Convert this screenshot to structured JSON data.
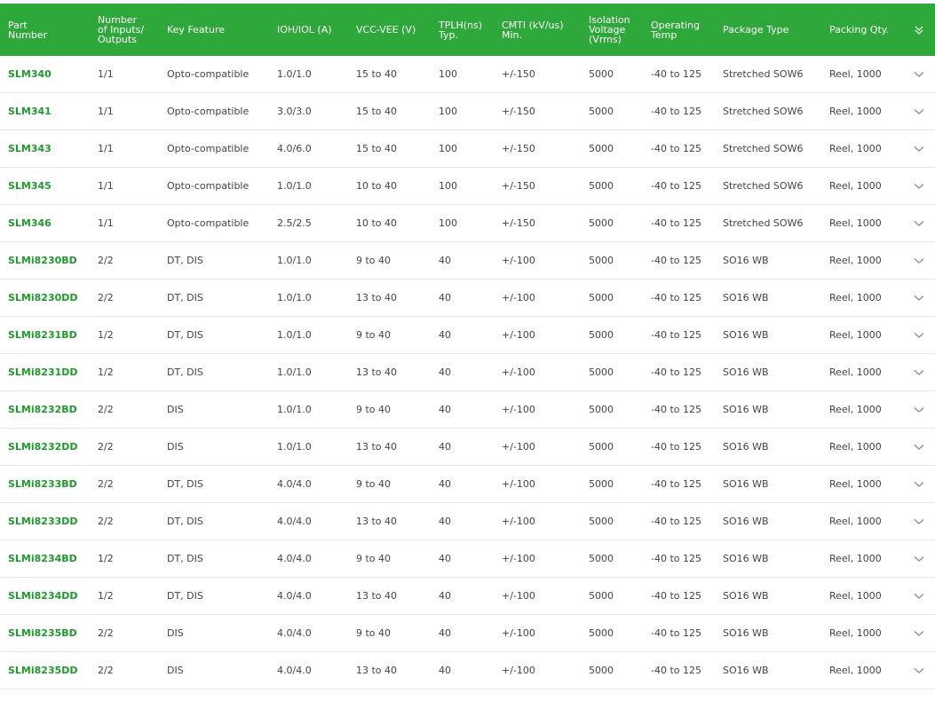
{
  "table": {
    "columns": [
      "Part\nNumber",
      "Number\nof Inputs/\nOutputs",
      "Key Feature",
      "IOH/IOL (A)",
      "VCC-VEE (V)",
      "TPLH(ns)\nTyp.",
      "CMTI (kV/us)\nMin.",
      "Isolation\nVoltage\n(Vrms)",
      "Operating\nTemp",
      "Package Type",
      "Packing Qty."
    ],
    "rows": [
      [
        "SLM340",
        "1/1",
        "Opto-compatible",
        "1.0/1.0",
        "15 to 40",
        "100",
        "+/-150",
        "5000",
        "-40 to 125",
        "Stretched SOW6",
        "Reel, 1000"
      ],
      [
        "SLM341",
        "1/1",
        "Opto-compatible",
        "3.0/3.0",
        "15 to 40",
        "100",
        "+/-150",
        "5000",
        "-40 to 125",
        "Stretched SOW6",
        "Reel, 1000"
      ],
      [
        "SLM343",
        "1/1",
        "Opto-compatible",
        "4.0/6.0",
        "15 to 40",
        "100",
        "+/-150",
        "5000",
        "-40 to 125",
        "Stretched SOW6",
        "Reel, 1000"
      ],
      [
        "SLM345",
        "1/1",
        "Opto-compatible",
        "1.0/1.0",
        "10 to 40",
        "100",
        "+/-150",
        "5000",
        "-40 to 125",
        "Stretched SOW6",
        "Reel, 1000"
      ],
      [
        "SLM346",
        "1/1",
        "Opto-compatible",
        "2.5/2.5",
        "10 to 40",
        "100",
        "+/-150",
        "5000",
        "-40 to 125",
        "Stretched SOW6",
        "Reel, 1000"
      ],
      [
        "SLMi8230BD",
        "2/2",
        "DT, DIS",
        "1.0/1.0",
        "9 to 40",
        "40",
        "+/-100",
        "5000",
        "-40 to 125",
        "SO16 WB",
        "Reel, 1000"
      ],
      [
        "SLMi8230DD",
        "2/2",
        "DT, DIS",
        "1.0/1.0",
        "13 to 40",
        "40",
        "+/-100",
        "5000",
        "-40 to 125",
        "SO16 WB",
        "Reel, 1000"
      ],
      [
        "SLMi8231BD",
        "1/2",
        "DT, DIS",
        "1.0/1.0",
        "9 to 40",
        "40",
        "+/-100",
        "5000",
        "-40 to 125",
        "SO16 WB",
        "Reel, 1000"
      ],
      [
        "SLMi8231DD",
        "1/2",
        "DT, DIS",
        "1.0/1.0",
        "13 to 40",
        "40",
        "+/-100",
        "5000",
        "-40 to 125",
        "SO16 WB",
        "Reel, 1000"
      ],
      [
        "SLMi8232BD",
        "2/2",
        "DIS",
        "1.0/1.0",
        "9 to 40",
        "40",
        "+/-100",
        "5000",
        "-40 to 125",
        "SO16 WB",
        "Reel, 1000"
      ],
      [
        "SLMi8232DD",
        "2/2",
        "DIS",
        "1.0/1.0",
        "13 to 40",
        "40",
        "+/-100",
        "5000",
        "-40 to 125",
        "SO16 WB",
        "Reel, 1000"
      ],
      [
        "SLMi8233BD",
        "2/2",
        "DT, DIS",
        "4.0/4.0",
        "9 to 40",
        "40",
        "+/-100",
        "5000",
        "-40 to 125",
        "SO16 WB",
        "Reel, 1000"
      ],
      [
        "SLMi8233DD",
        "2/2",
        "DT, DIS",
        "4.0/4.0",
        "13 to 40",
        "40",
        "+/-100",
        "5000",
        "-40 to 125",
        "SO16 WB",
        "Reel, 1000"
      ],
      [
        "SLMi8234BD",
        "1/2",
        "DT, DIS",
        "4.0/4.0",
        "9 to 40",
        "40",
        "+/-100",
        "5000",
        "-40 to 125",
        "SO16 WB",
        "Reel, 1000"
      ],
      [
        "SLMi8234DD",
        "1/2",
        "DT, DIS",
        "4.0/4.0",
        "13 to 40",
        "40",
        "+/-100",
        "5000",
        "-40 to 125",
        "SO16 WB",
        "Reel, 1000"
      ],
      [
        "SLMi8235BD",
        "2/2",
        "DIS",
        "4.0/4.0",
        "9 to 40",
        "40",
        "+/-100",
        "5000",
        "-40 to 125",
        "SO16 WB",
        "Reel, 1000"
      ],
      [
        "SLMi8235DD",
        "2/2",
        "DIS",
        "4.0/4.0",
        "13 to 40",
        "40",
        "+/-100",
        "5000",
        "-40 to 125",
        "SO16 WB",
        "Reel, 1000"
      ]
    ],
    "row_expand_icon": "chevron-down-icon",
    "header_expand_icon": "double-chevron-down-icon"
  },
  "colors": {
    "header_bg": "#2ea83a",
    "part_number_text": "#1f9a2c",
    "row_divider": "#e6e6e6"
  }
}
